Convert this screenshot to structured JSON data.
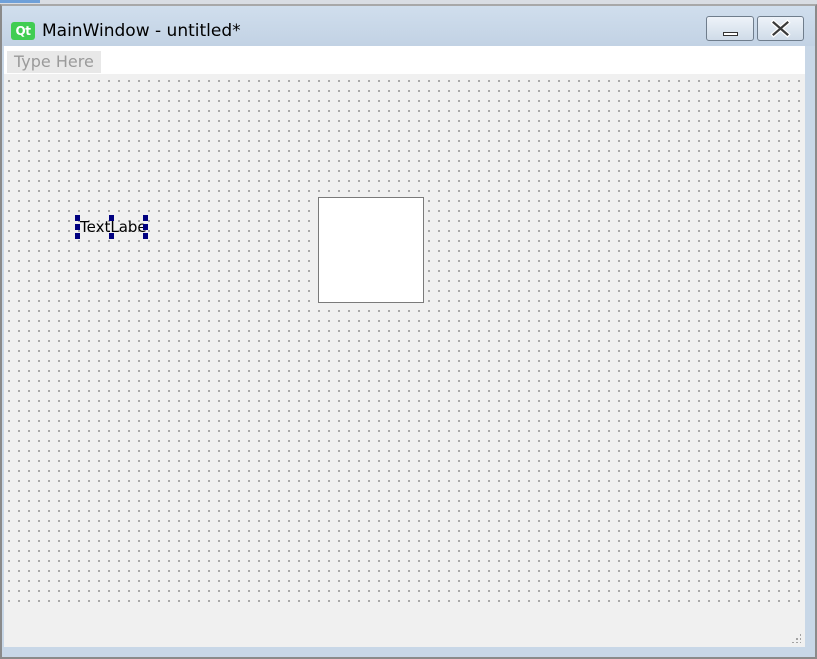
{
  "window": {
    "title": "MainWindow - untitled*",
    "app_logo_text": "Qt",
    "app_logo_color": "#41cd52",
    "buttons": {
      "minimize_icon": "minimize-icon",
      "close_icon": "close-icon"
    }
  },
  "menubar": {
    "placeholder": "Type Here"
  },
  "form": {
    "widgets": [
      {
        "type": "label",
        "text": "TextLabel",
        "selected": true,
        "selection_color": "#000080"
      },
      {
        "type": "frame",
        "text": ""
      }
    ],
    "background_color": "#f0f0f0",
    "grid": true
  }
}
